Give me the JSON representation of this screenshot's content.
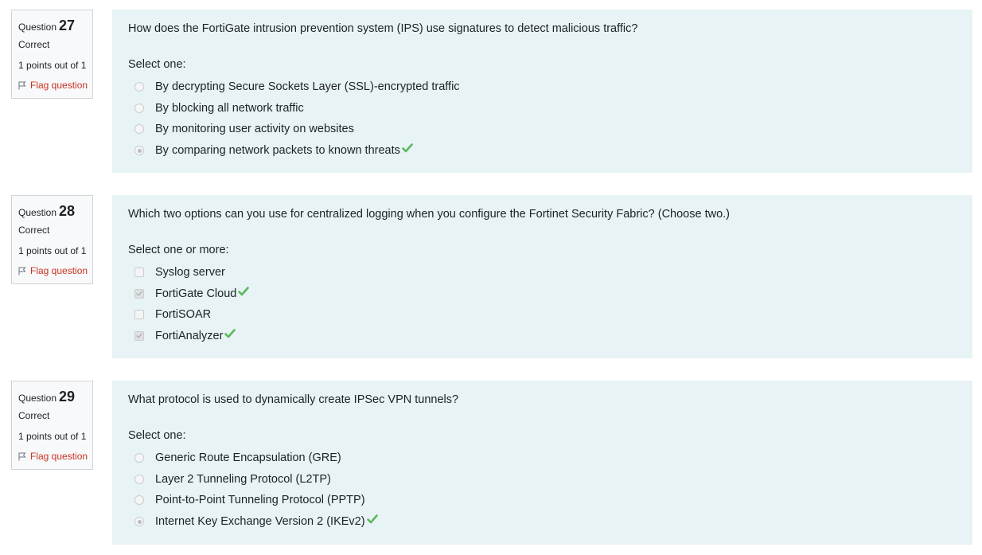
{
  "questions": [
    {
      "word": "Question",
      "number": "27",
      "state": "Correct",
      "grade": "1 points out of 1",
      "flag_label": "Flag question",
      "text": "How does the FortiGate intrusion prevention system (IPS) use signatures to detect malicious traffic?",
      "prompt": "Select one:",
      "input_type": "radio",
      "answers": [
        {
          "label": "By decrypting Secure Sockets Layer (SSL)-encrypted traffic",
          "selected": false,
          "correct": false
        },
        {
          "label": "By blocking all network traffic",
          "selected": false,
          "correct": false
        },
        {
          "label": "By monitoring user activity on websites",
          "selected": false,
          "correct": false
        },
        {
          "label": "By comparing network packets to known threats",
          "selected": true,
          "correct": true
        }
      ]
    },
    {
      "word": "Question",
      "number": "28",
      "state": "Correct",
      "grade": "1 points out of 1",
      "flag_label": "Flag question",
      "text": "Which two options can you use for centralized logging when you configure the Fortinet Security Fabric? (Choose two.)",
      "prompt": "Select one or more:",
      "input_type": "checkbox",
      "answers": [
        {
          "label": "Syslog server",
          "selected": false,
          "correct": false
        },
        {
          "label": "FortiGate Cloud",
          "selected": true,
          "correct": true
        },
        {
          "label": "FortiSOAR",
          "selected": false,
          "correct": false
        },
        {
          "label": "FortiAnalyzer",
          "selected": true,
          "correct": true
        }
      ]
    },
    {
      "word": "Question",
      "number": "29",
      "state": "Correct",
      "grade": "1 points out of 1",
      "flag_label": "Flag question",
      "text": "What protocol is used to dynamically create IPSec VPN tunnels?",
      "prompt": "Select one:",
      "input_type": "radio",
      "answers": [
        {
          "label": "Generic Route Encapsulation (GRE)",
          "selected": false,
          "correct": false
        },
        {
          "label": "Layer 2 Tunneling Protocol (L2TP)",
          "selected": false,
          "correct": false
        },
        {
          "label": "Point-to-Point Tunneling Protocol (PPTP)",
          "selected": false,
          "correct": false
        },
        {
          "label": "Internet Key Exchange Version 2 (IKEv2)",
          "selected": true,
          "correct": true
        }
      ]
    }
  ],
  "colors": {
    "content_bg": "#e7f3f5",
    "flag": "#ca3120",
    "tick": "#5cb85c"
  }
}
